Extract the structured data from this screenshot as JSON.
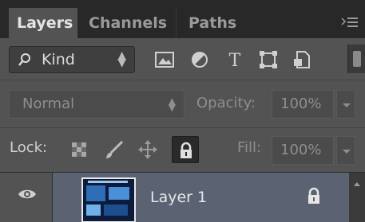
{
  "tabs": [
    {
      "label": "Layers"
    },
    {
      "label": "Channels"
    },
    {
      "label": "Paths"
    }
  ],
  "filter": {
    "kind_label": "Kind",
    "icons": [
      "image-filter-icon",
      "adjustment-filter-icon",
      "type-filter-icon",
      "shape-filter-icon",
      "smart-object-filter-icon"
    ],
    "type_glyph": "T"
  },
  "blend": {
    "mode": "Normal",
    "opacity_label": "Opacity:",
    "opacity_value": "100%"
  },
  "lock": {
    "label": "Lock:",
    "fill_label": "Fill:",
    "fill_value": "100%"
  },
  "layer": {
    "name": "Layer 1",
    "visible": true,
    "locked": true
  },
  "colors": {
    "panel": "#535353",
    "tabbar": "#282828",
    "selected_row": "#5b6373"
  }
}
